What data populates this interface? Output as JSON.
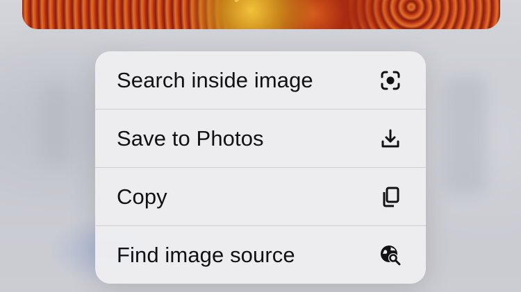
{
  "menu": {
    "items": [
      {
        "label": "Search inside image",
        "icon": "visual-lookup-icon"
      },
      {
        "label": "Save to Photos",
        "icon": "download-icon"
      },
      {
        "label": "Copy",
        "icon": "copy-icon"
      },
      {
        "label": "Find image source",
        "icon": "globe-search-icon"
      }
    ]
  },
  "colors": {
    "menu_background": "#eeeef0",
    "text": "#111114",
    "divider": "#cfcfd3"
  }
}
